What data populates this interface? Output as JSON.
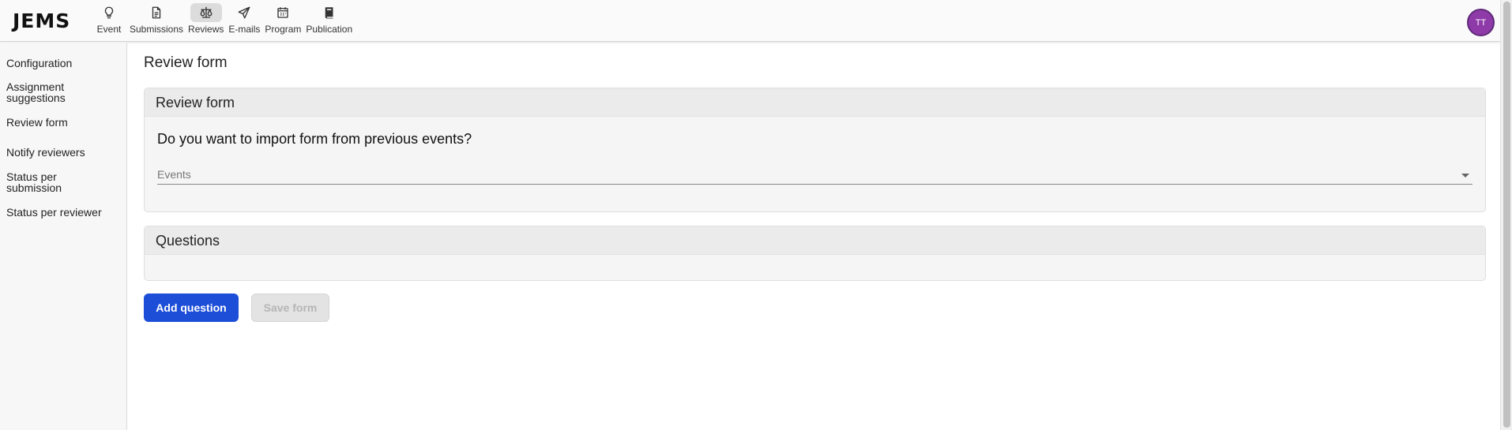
{
  "app": {
    "logo": "JEMS"
  },
  "nav": [
    {
      "label": "Event",
      "icon": "lightbulb-icon"
    },
    {
      "label": "Submissions",
      "icon": "document-icon"
    },
    {
      "label": "Reviews",
      "icon": "scale-icon",
      "active": true
    },
    {
      "label": "E-mails",
      "icon": "paper-plane-icon"
    },
    {
      "label": "Program",
      "icon": "calendar-icon"
    },
    {
      "label": "Publication",
      "icon": "book-icon"
    }
  ],
  "user": {
    "initials": "TT",
    "avatar_color": "#8e3aa8"
  },
  "sidebar": {
    "items": [
      {
        "label": "Configuration"
      },
      {
        "label": "Assignment suggestions"
      },
      {
        "label": "Review form"
      },
      {
        "label": "Notify reviewers"
      },
      {
        "label": "Status per submission"
      },
      {
        "label": "Status per reviewer"
      }
    ]
  },
  "page": {
    "title": "Review form"
  },
  "import_card": {
    "header": "Review form",
    "question": "Do you want to import form from previous events?",
    "select_placeholder": "Events"
  },
  "questions_card": {
    "header": "Questions"
  },
  "actions": {
    "add_question": "Add question",
    "save_form": "Save form"
  },
  "colors": {
    "primary": "#1d4ed8",
    "avatar": "#8e3aa8"
  }
}
